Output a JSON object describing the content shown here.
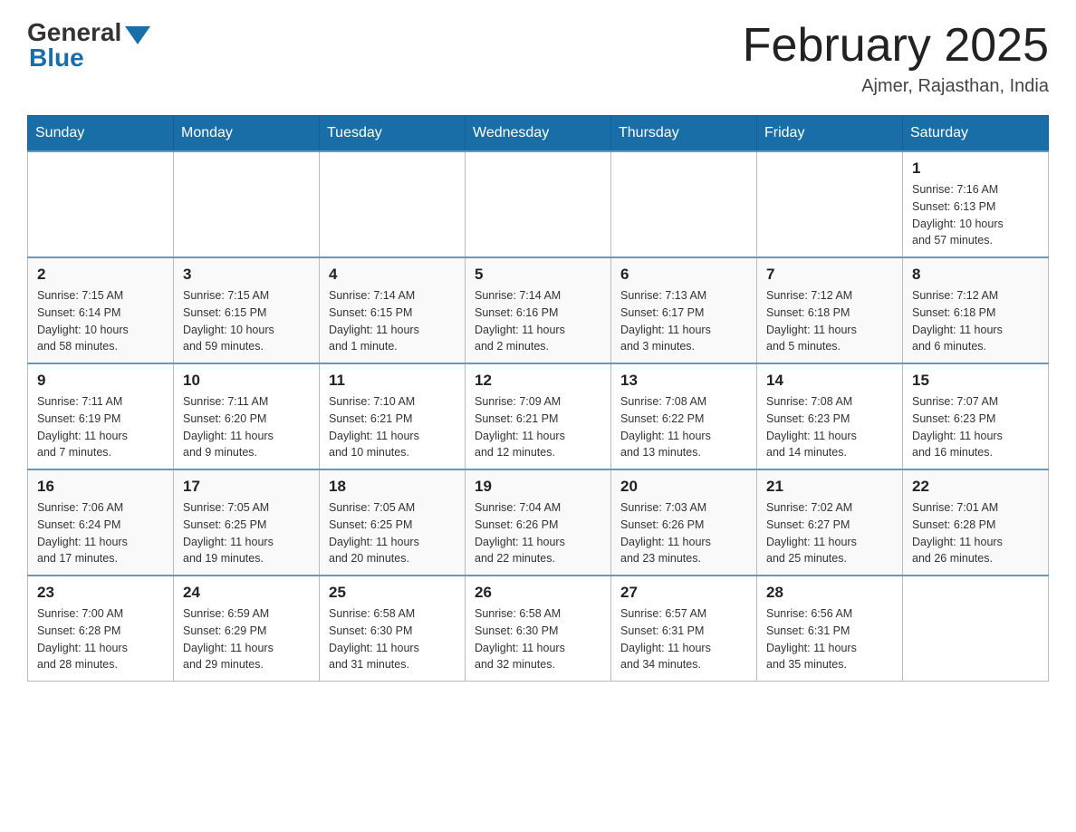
{
  "header": {
    "logo_general": "General",
    "logo_blue": "Blue",
    "month_title": "February 2025",
    "location": "Ajmer, Rajasthan, India"
  },
  "weekdays": [
    "Sunday",
    "Monday",
    "Tuesday",
    "Wednesday",
    "Thursday",
    "Friday",
    "Saturday"
  ],
  "weeks": [
    [
      {
        "day": "",
        "info": ""
      },
      {
        "day": "",
        "info": ""
      },
      {
        "day": "",
        "info": ""
      },
      {
        "day": "",
        "info": ""
      },
      {
        "day": "",
        "info": ""
      },
      {
        "day": "",
        "info": ""
      },
      {
        "day": "1",
        "info": "Sunrise: 7:16 AM\nSunset: 6:13 PM\nDaylight: 10 hours\nand 57 minutes."
      }
    ],
    [
      {
        "day": "2",
        "info": "Sunrise: 7:15 AM\nSunset: 6:14 PM\nDaylight: 10 hours\nand 58 minutes."
      },
      {
        "day": "3",
        "info": "Sunrise: 7:15 AM\nSunset: 6:15 PM\nDaylight: 10 hours\nand 59 minutes."
      },
      {
        "day": "4",
        "info": "Sunrise: 7:14 AM\nSunset: 6:15 PM\nDaylight: 11 hours\nand 1 minute."
      },
      {
        "day": "5",
        "info": "Sunrise: 7:14 AM\nSunset: 6:16 PM\nDaylight: 11 hours\nand 2 minutes."
      },
      {
        "day": "6",
        "info": "Sunrise: 7:13 AM\nSunset: 6:17 PM\nDaylight: 11 hours\nand 3 minutes."
      },
      {
        "day": "7",
        "info": "Sunrise: 7:12 AM\nSunset: 6:18 PM\nDaylight: 11 hours\nand 5 minutes."
      },
      {
        "day": "8",
        "info": "Sunrise: 7:12 AM\nSunset: 6:18 PM\nDaylight: 11 hours\nand 6 minutes."
      }
    ],
    [
      {
        "day": "9",
        "info": "Sunrise: 7:11 AM\nSunset: 6:19 PM\nDaylight: 11 hours\nand 7 minutes."
      },
      {
        "day": "10",
        "info": "Sunrise: 7:11 AM\nSunset: 6:20 PM\nDaylight: 11 hours\nand 9 minutes."
      },
      {
        "day": "11",
        "info": "Sunrise: 7:10 AM\nSunset: 6:21 PM\nDaylight: 11 hours\nand 10 minutes."
      },
      {
        "day": "12",
        "info": "Sunrise: 7:09 AM\nSunset: 6:21 PM\nDaylight: 11 hours\nand 12 minutes."
      },
      {
        "day": "13",
        "info": "Sunrise: 7:08 AM\nSunset: 6:22 PM\nDaylight: 11 hours\nand 13 minutes."
      },
      {
        "day": "14",
        "info": "Sunrise: 7:08 AM\nSunset: 6:23 PM\nDaylight: 11 hours\nand 14 minutes."
      },
      {
        "day": "15",
        "info": "Sunrise: 7:07 AM\nSunset: 6:23 PM\nDaylight: 11 hours\nand 16 minutes."
      }
    ],
    [
      {
        "day": "16",
        "info": "Sunrise: 7:06 AM\nSunset: 6:24 PM\nDaylight: 11 hours\nand 17 minutes."
      },
      {
        "day": "17",
        "info": "Sunrise: 7:05 AM\nSunset: 6:25 PM\nDaylight: 11 hours\nand 19 minutes."
      },
      {
        "day": "18",
        "info": "Sunrise: 7:05 AM\nSunset: 6:25 PM\nDaylight: 11 hours\nand 20 minutes."
      },
      {
        "day": "19",
        "info": "Sunrise: 7:04 AM\nSunset: 6:26 PM\nDaylight: 11 hours\nand 22 minutes."
      },
      {
        "day": "20",
        "info": "Sunrise: 7:03 AM\nSunset: 6:26 PM\nDaylight: 11 hours\nand 23 minutes."
      },
      {
        "day": "21",
        "info": "Sunrise: 7:02 AM\nSunset: 6:27 PM\nDaylight: 11 hours\nand 25 minutes."
      },
      {
        "day": "22",
        "info": "Sunrise: 7:01 AM\nSunset: 6:28 PM\nDaylight: 11 hours\nand 26 minutes."
      }
    ],
    [
      {
        "day": "23",
        "info": "Sunrise: 7:00 AM\nSunset: 6:28 PM\nDaylight: 11 hours\nand 28 minutes."
      },
      {
        "day": "24",
        "info": "Sunrise: 6:59 AM\nSunset: 6:29 PM\nDaylight: 11 hours\nand 29 minutes."
      },
      {
        "day": "25",
        "info": "Sunrise: 6:58 AM\nSunset: 6:30 PM\nDaylight: 11 hours\nand 31 minutes."
      },
      {
        "day": "26",
        "info": "Sunrise: 6:58 AM\nSunset: 6:30 PM\nDaylight: 11 hours\nand 32 minutes."
      },
      {
        "day": "27",
        "info": "Sunrise: 6:57 AM\nSunset: 6:31 PM\nDaylight: 11 hours\nand 34 minutes."
      },
      {
        "day": "28",
        "info": "Sunrise: 6:56 AM\nSunset: 6:31 PM\nDaylight: 11 hours\nand 35 minutes."
      },
      {
        "day": "",
        "info": ""
      }
    ]
  ]
}
